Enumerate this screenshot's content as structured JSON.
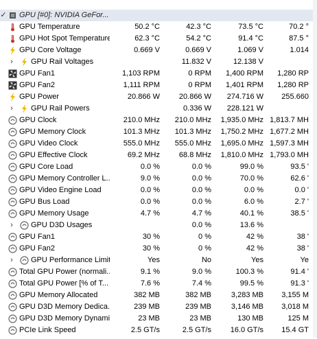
{
  "header": {
    "label": "GPU [#0]: NVIDIA GeFor..."
  },
  "rows": [
    {
      "label": "GPU Temperature",
      "icon": "thermometer-icon",
      "values": [
        "50.2 °C",
        "42.3 °C",
        "73.5 °C",
        "70.2 °"
      ]
    },
    {
      "label": "GPU Hot Spot Temperature",
      "icon": "thermometer-icon",
      "values": [
        "62.3 °C",
        "54.2 °C",
        "91.4 °C",
        "87.5 °"
      ]
    },
    {
      "label": "GPU Core Voltage",
      "icon": "lightning-icon",
      "values": [
        "0.669 V",
        "0.669 V",
        "1.069 V",
        "1.014"
      ]
    },
    {
      "label": "GPU Rail Voltages",
      "icon": "lightning-icon",
      "expandable": true,
      "values": [
        "",
        "11.832 V",
        "12.138 V",
        ""
      ]
    },
    {
      "label": "GPU Fan1",
      "icon": "fan-icon",
      "values": [
        "1,103 RPM",
        "0 RPM",
        "1,400 RPM",
        "1,280 RP"
      ]
    },
    {
      "label": "GPU Fan2",
      "icon": "fan-icon",
      "values": [
        "1,111 RPM",
        "0 RPM",
        "1,401 RPM",
        "1,280 RP"
      ]
    },
    {
      "label": "GPU Power",
      "icon": "lightning-icon",
      "values": [
        "20.866 W",
        "20.866 W",
        "274.716 W",
        "255.660"
      ]
    },
    {
      "label": "GPU Rail Powers",
      "icon": "lightning-icon",
      "expandable": true,
      "values": [
        "",
        "0.336 W",
        "228.121 W",
        ""
      ]
    },
    {
      "label": "GPU Clock",
      "icon": "clock-icon",
      "values": [
        "210.0 MHz",
        "210.0 MHz",
        "1,935.0 MHz",
        "1,813.7 MH"
      ]
    },
    {
      "label": "GPU Memory Clock",
      "icon": "clock-icon",
      "values": [
        "101.3 MHz",
        "101.3 MHz",
        "1,750.2 MHz",
        "1,677.2 MH"
      ]
    },
    {
      "label": "GPU Video Clock",
      "icon": "clock-icon",
      "values": [
        "555.0 MHz",
        "555.0 MHz",
        "1,695.0 MHz",
        "1,597.3 MH"
      ]
    },
    {
      "label": "GPU Effective Clock",
      "icon": "clock-icon",
      "values": [
        "69.2 MHz",
        "68.8 MHz",
        "1,810.0 MHz",
        "1,793.0 MH"
      ]
    },
    {
      "label": "GPU Core Load",
      "icon": "clock-icon",
      "values": [
        "0.0 %",
        "0.0 %",
        "99.0 %",
        "93.5 '"
      ]
    },
    {
      "label": "GPU Memory Controller L...",
      "icon": "clock-icon",
      "values": [
        "9.0 %",
        "0.0 %",
        "70.0 %",
        "62.6 '"
      ]
    },
    {
      "label": "GPU Video Engine Load",
      "icon": "clock-icon",
      "values": [
        "0.0 %",
        "0.0 %",
        "0.0 %",
        "0.0 '"
      ]
    },
    {
      "label": "GPU Bus Load",
      "icon": "clock-icon",
      "values": [
        "0.0 %",
        "0.0 %",
        "6.0 %",
        "2.7 '"
      ]
    },
    {
      "label": "GPU Memory Usage",
      "icon": "clock-icon",
      "values": [
        "4.7 %",
        "4.7 %",
        "40.1 %",
        "38.5 '"
      ]
    },
    {
      "label": "GPU D3D Usages",
      "icon": "clock-icon",
      "expandable": true,
      "values": [
        "",
        "0.0 %",
        "13.6 %",
        ""
      ]
    },
    {
      "label": "GPU Fan1",
      "icon": "clock-icon",
      "values": [
        "30 %",
        "0 %",
        "42 %",
        "38 '"
      ]
    },
    {
      "label": "GPU Fan2",
      "icon": "clock-icon",
      "values": [
        "30 %",
        "0 %",
        "42 %",
        "38 '"
      ]
    },
    {
      "label": "GPU Performance Limits",
      "icon": "clock-icon",
      "expandable": true,
      "values": [
        "Yes",
        "No",
        "Yes",
        "Ye"
      ]
    },
    {
      "label": "Total GPU Power (normali...",
      "icon": "clock-icon",
      "values": [
        "9.1 %",
        "9.0 %",
        "100.3 %",
        "91.4 '"
      ]
    },
    {
      "label": "Total GPU Power [% of T...",
      "icon": "clock-icon",
      "values": [
        "7.6 %",
        "7.4 %",
        "99.5 %",
        "91.3 '"
      ]
    },
    {
      "label": "GPU Memory Allocated",
      "icon": "clock-icon",
      "values": [
        "382 MB",
        "382 MB",
        "3,283 MB",
        "3,155 M"
      ]
    },
    {
      "label": "GPU D3D Memory Dedica...",
      "icon": "clock-icon",
      "values": [
        "239 MB",
        "239 MB",
        "3,146 MB",
        "3,018 M"
      ]
    },
    {
      "label": "GPU D3D Memory Dynamic",
      "icon": "clock-icon",
      "values": [
        "23 MB",
        "23 MB",
        "130 MB",
        "125 M"
      ]
    },
    {
      "label": "PCIe Link Speed",
      "icon": "clock-icon",
      "values": [
        "2.5 GT/s",
        "2.5 GT/s",
        "16.0 GT/s",
        "15.4 GT"
      ]
    }
  ]
}
